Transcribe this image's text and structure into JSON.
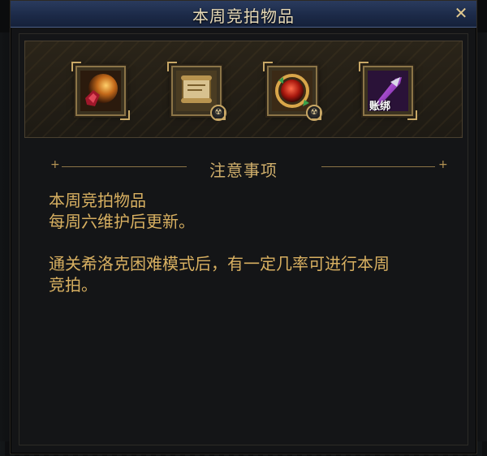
{
  "window": {
    "title": "本周竞拍物品",
    "close_label": "✕"
  },
  "items": [
    {
      "name": "orb-item",
      "badge": ""
    },
    {
      "name": "scroll-item",
      "badge": "☢"
    },
    {
      "name": "sphere-item",
      "badge": "☢"
    },
    {
      "name": "sword-item",
      "overlay_text": "账绑"
    }
  ],
  "notice": {
    "heading": "注意事项",
    "lines": [
      "本周竞拍物品",
      "每周六维护后更新。",
      "",
      "通关希洛克困难模式后，有一定几率可进行本周",
      "竞拍。"
    ]
  },
  "colors": {
    "title_bar": "#1c2a48",
    "gold_text": "#d8b061",
    "frame_gold": "#8b7447"
  }
}
